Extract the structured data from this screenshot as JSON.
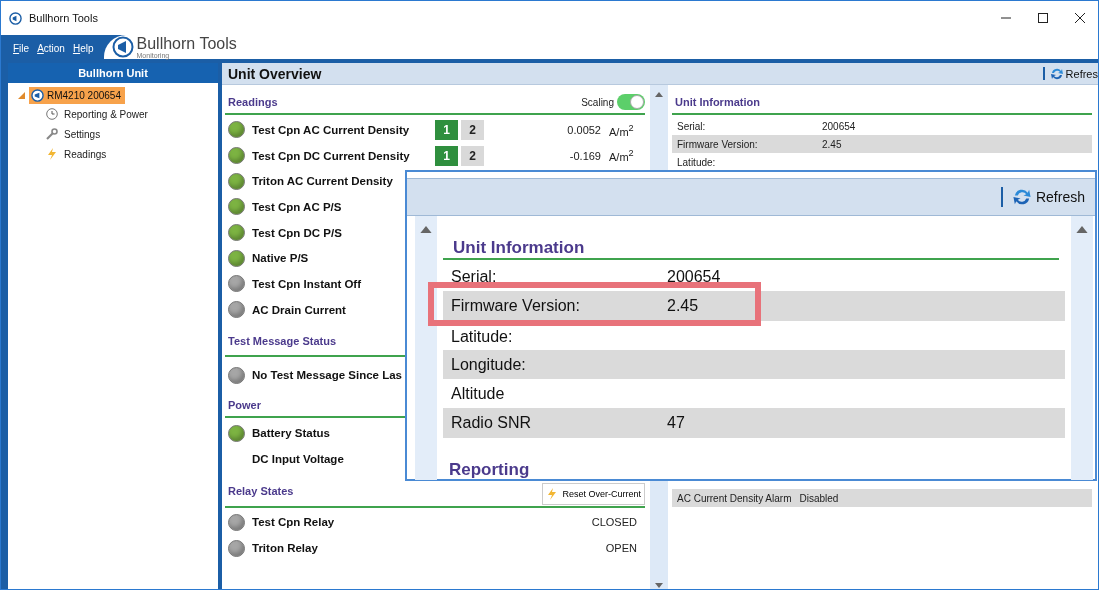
{
  "window": {
    "title": "Bullhorn Tools"
  },
  "menu": [
    {
      "label": "File"
    },
    {
      "label": "Action"
    },
    {
      "label": "Help"
    }
  ],
  "logo": {
    "name": "Bullhorn Tools",
    "subtitle": "Monitoring"
  },
  "sidebar": {
    "title": "Bullhorn Unit",
    "tree": [
      {
        "label": "RM4210 200654",
        "expanded": true,
        "selected": true,
        "children": [
          {
            "label": "Reporting & Power",
            "kind": "clock",
            "selected": false
          },
          {
            "label": "Settings",
            "kind": "wrench",
            "selected": false
          },
          {
            "label": "Readings",
            "kind": "bolt",
            "selected": false
          }
        ]
      }
    ]
  },
  "header": {
    "title": "Unit Overview",
    "refresh": "Refres"
  },
  "sections": [
    {
      "title": "Readings",
      "scaling": {
        "label": "Scaling",
        "on": true
      },
      "rows": [
        {
          "label": "Test Cpn AC Current Density",
          "color": "#7cb342",
          "channels": [
            {
              "label": "1",
              "selected": true
            },
            {
              "label": "2",
              "selected": false
            }
          ],
          "value": "0.0052",
          "unit": "A/m$^{2}$"
        },
        {
          "label": "Test Cpn DC Current Density",
          "color": "#7cb342",
          "channels": [
            {
              "label": "1",
              "selected": true
            },
            {
              "label": "2",
              "selected": false
            }
          ],
          "value": "-0.169",
          "unit": "A/m$^{2}$"
        },
        {
          "label": "Triton AC Current Density",
          "color": "#7cb342"
        },
        {
          "label": "Test Cpn AC P/S",
          "color": "#7cb342"
        },
        {
          "label": "Test Cpn DC P/S",
          "color": "#7cb342"
        },
        {
          "label": "Native P/S",
          "color": "#7cb342"
        },
        {
          "label": "Test Cpn Instant Off",
          "color": "#a6a6a6"
        },
        {
          "label": "AC Drain Current",
          "color": "#a6a6a6"
        }
      ]
    },
    {
      "title": "Test Message Status",
      "rows": [
        {
          "label": "No Test Message Since Las",
          "color": "#a6a6a6"
        }
      ]
    },
    {
      "title": "Power",
      "rows": [
        {
          "label": "Battery Status",
          "color": "#7cb342"
        },
        {
          "label": "DC Input Voltage"
        }
      ]
    },
    {
      "title": "Relay States",
      "button": "Reset Over-Current",
      "rows": [
        {
          "label": "Test Cpn Relay",
          "color": "#a6a6a6",
          "value": "CLOSED"
        },
        {
          "label": "Triton Relay",
          "color": "#a6a6a6",
          "value": "OPEN"
        }
      ]
    }
  ],
  "unit_information": {
    "title": "Unit Information",
    "rows": [
      {
        "label": "Serial:",
        "value": "200654"
      },
      {
        "label": "Firmware Version:",
        "value": "2.45"
      },
      {
        "label": "Latitude:"
      }
    ]
  },
  "alarm_row": {
    "label": "AC Current Density Alarm",
    "value": "Disabled"
  },
  "callout": {
    "refresh": "Refresh",
    "title": "Unit Information",
    "rows": [
      {
        "label": "Serial:",
        "value": "200654",
        "highlighted": false
      },
      {
        "label": "Firmware Version:",
        "value": "2.45",
        "highlighted": true
      },
      {
        "label": "Latitude:",
        "highlighted": false
      },
      {
        "label": "Longitude:",
        "highlighted": false
      },
      {
        "label": "Altitude",
        "highlighted": false
      },
      {
        "label": "Radio SNR",
        "value": "47",
        "highlighted": false
      }
    ],
    "next_section": "Reporting"
  }
}
